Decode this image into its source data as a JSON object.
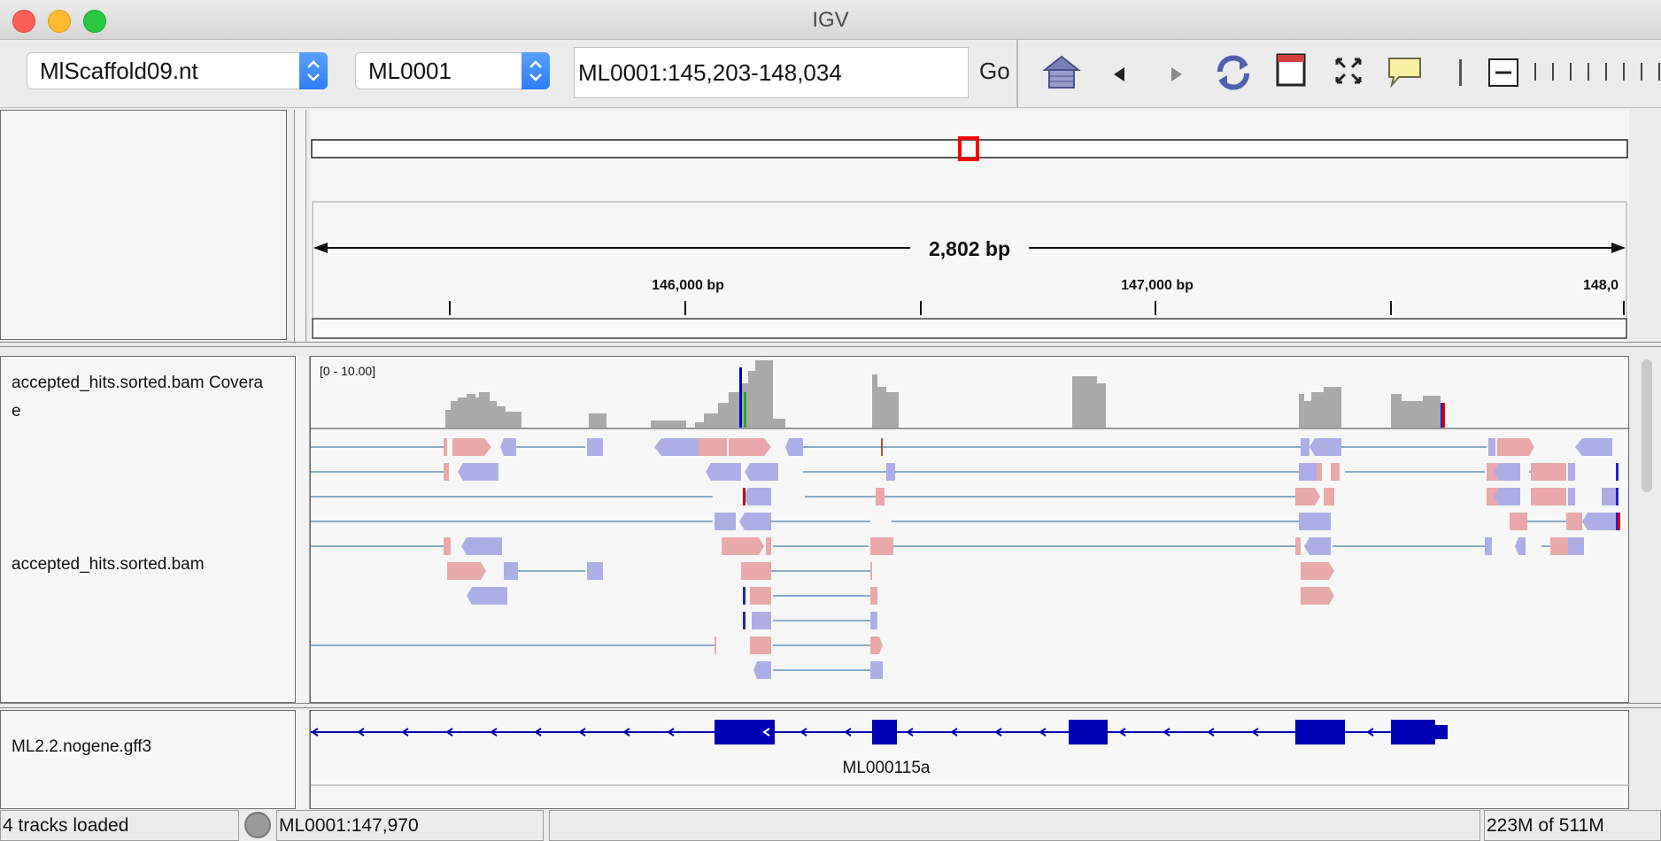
{
  "window": {
    "title": "IGV"
  },
  "toolbar": {
    "genome_select": "MlScaffold09.nt",
    "chromosome_select": "ML0001",
    "locus_value": "ML0001:145,203-148,034",
    "go_label": "Go",
    "icons": [
      "home-icon",
      "back-arrow-icon",
      "forward-arrow-icon",
      "refresh-icon",
      "region-of-interest-icon",
      "resize-to-window-icon",
      "popup-info-icon",
      "zoom-slider-icon"
    ]
  },
  "ruler": {
    "span_label": "2,802 bp",
    "tick_labels": [
      "146,000 bp",
      "147,000 bp",
      "148,0"
    ]
  },
  "tracks": {
    "coverage": {
      "name": "accepted_hits.sorted.bam Covera\ne",
      "range_label": "[0 - 10.00]"
    },
    "alignments": {
      "name": "accepted_hits.sorted.bam"
    },
    "annotation": {
      "name": "ML2.2.nogene.gff3",
      "feature_label": "ML000115a"
    }
  },
  "colors": {
    "coverage_gray": "#a9a9a9",
    "read_forward": "#e9a8aa",
    "read_reverse": "#aeaee6",
    "gene_blue": "#0000b4",
    "region_red": "#ff0000"
  },
  "status": {
    "tracks_loaded": "4 tracks loaded",
    "position": "ML0001:147,970",
    "message": "",
    "memory": "223M of 511M"
  }
}
